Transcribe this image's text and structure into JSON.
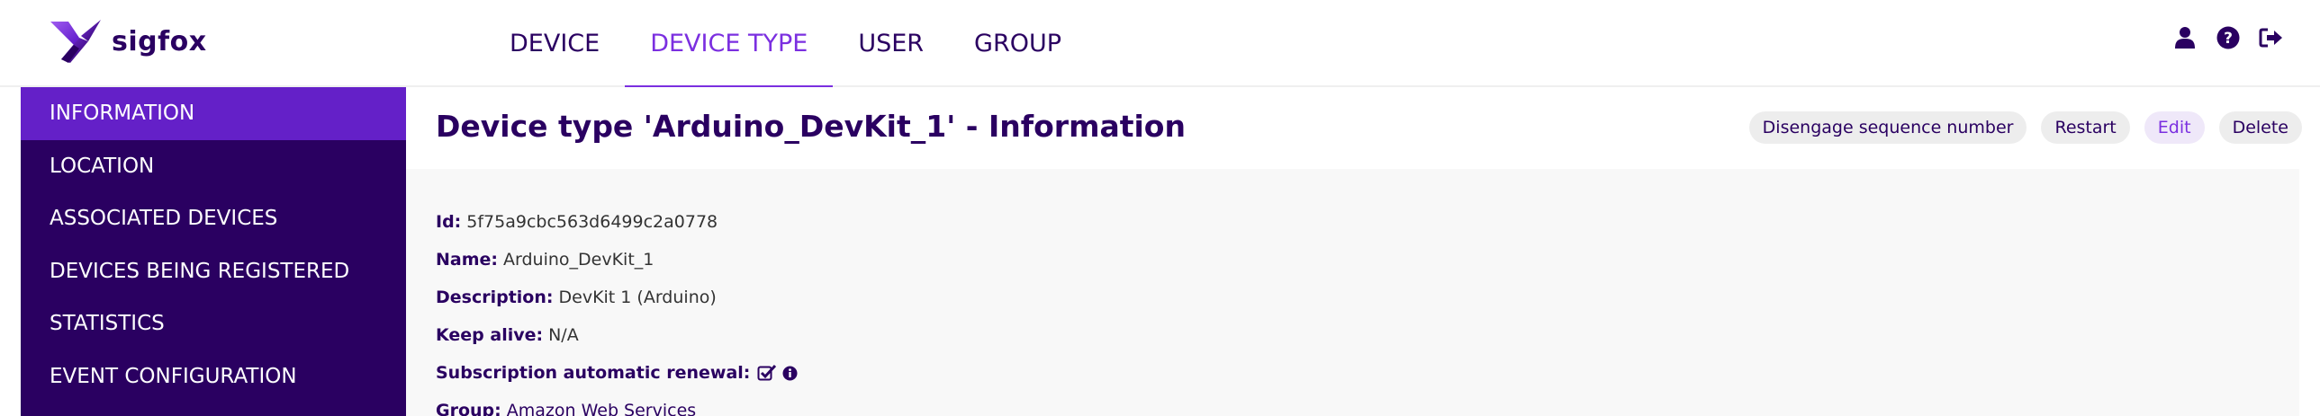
{
  "header": {
    "brand": "sigfox",
    "nav": [
      {
        "label": "DEVICE",
        "active": false
      },
      {
        "label": "DEVICE TYPE",
        "active": true
      },
      {
        "label": "USER",
        "active": false
      },
      {
        "label": "GROUP",
        "active": false
      }
    ],
    "icons": [
      "user-icon",
      "help-icon",
      "logout-icon"
    ]
  },
  "sidebar": {
    "items": [
      {
        "label": "INFORMATION",
        "active": true
      },
      {
        "label": "LOCATION",
        "active": false
      },
      {
        "label": "ASSOCIATED DEVICES",
        "active": false
      },
      {
        "label": "DEVICES BEING REGISTERED",
        "active": false
      },
      {
        "label": "STATISTICS",
        "active": false
      },
      {
        "label": "EVENT CONFIGURATION",
        "active": false
      }
    ]
  },
  "main": {
    "title": "Device type 'Arduino_DevKit_1' - Information",
    "actions": {
      "disengage": "Disengage sequence number",
      "restart": "Restart",
      "edit": "Edit",
      "delete": "Delete"
    },
    "fields": {
      "id": {
        "label": "Id:",
        "value": "5f75a9cbc563d6499c2a0778"
      },
      "name": {
        "label": "Name:",
        "value": "Arduino_DevKit_1"
      },
      "description": {
        "label": "Description:",
        "value": "DevKit 1 (Arduino)"
      },
      "keep_alive": {
        "label": "Keep alive:",
        "value": "N/A"
      },
      "subscription": {
        "label": "Subscription automatic renewal:",
        "checked": true
      },
      "group": {
        "label": "Group:",
        "value": "Amazon Web Services"
      }
    }
  },
  "colors": {
    "brand": "#2a0061",
    "accent": "#7b2fe0",
    "sidebar_active": "#6420c8",
    "content_bg": "#f8f8f8"
  }
}
